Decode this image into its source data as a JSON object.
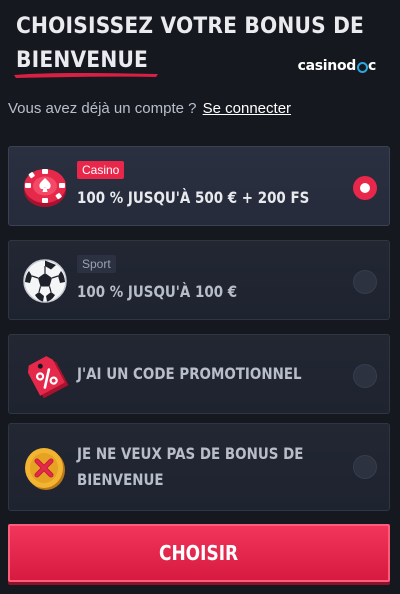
{
  "header": {
    "title_line1": "CHOISISSEZ VOTRE BONUS DE",
    "title_line2": "BIENVENUE",
    "logo_text": "casinod",
    "logo_tail": "c"
  },
  "login": {
    "prompt": "Vous avez déjà un compte ?",
    "link_label": "Se connecter"
  },
  "options": [
    {
      "badge": "Casino",
      "line1": "100 % JUSQU'À 500 € + 200 FS",
      "line2": "",
      "selected": true,
      "icon": "casino-chip-icon"
    },
    {
      "badge": "Sport",
      "line1": "100 % JUSQU'À 100 €",
      "line2": "",
      "selected": false,
      "icon": "soccer-ball-icon"
    },
    {
      "badge": "",
      "line1": "J'AI UN CODE PROMOTIONNEL",
      "line2": "",
      "selected": false,
      "icon": "percent-tag-icon"
    },
    {
      "badge": "",
      "line1": "JE NE VEUX PAS DE BONUS DE",
      "line2": "BIENVENUE",
      "selected": false,
      "icon": "no-bonus-coin-icon"
    }
  ],
  "cta": {
    "label": "CHOISIR"
  },
  "colors": {
    "accent": "#e8274b",
    "background": "#15181f",
    "card": "#222732",
    "logo_ring": "#2ca7e0"
  }
}
